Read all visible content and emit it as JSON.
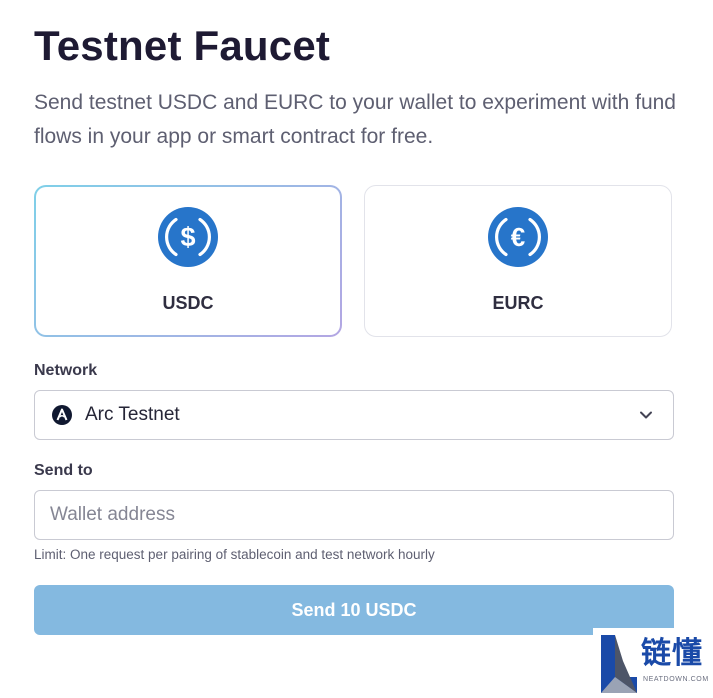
{
  "header": {
    "title": "Testnet Faucet",
    "subtitle": "Send testnet USDC and EURC to your wallet to experiment with fund flows in your app or smart contract for free."
  },
  "tokens": [
    {
      "label": "USDC",
      "symbol": "$",
      "icon": "usdc-coin-icon",
      "selected": true
    },
    {
      "label": "EURC",
      "symbol": "€",
      "icon": "eurc-coin-icon",
      "selected": false
    }
  ],
  "network": {
    "label": "Network",
    "value": "Arc Testnet",
    "icon": "arc-network-icon"
  },
  "send_to": {
    "label": "Send to",
    "placeholder": "Wallet address",
    "value": ""
  },
  "limit_text": "Limit: One request per pairing of stablecoin and test network hourly",
  "send_button": {
    "label": "Send 10 USDC"
  },
  "watermark": {
    "text": "链懂",
    "domain": "NEATDOWN.COM"
  },
  "colors": {
    "coin_blue": "#2775ca",
    "button_bg": "#84b9e0",
    "title": "#1e1a33"
  }
}
